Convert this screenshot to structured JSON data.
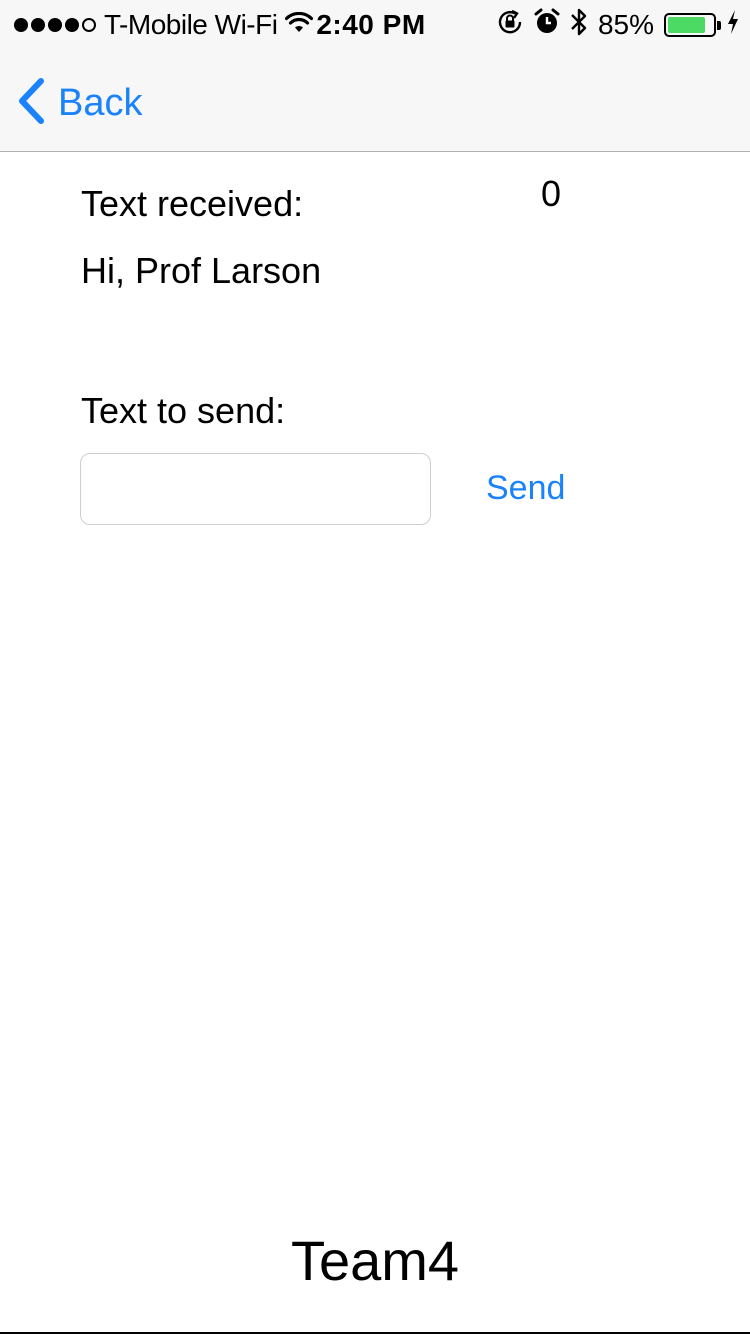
{
  "status_bar": {
    "carrier": "T-Mobile Wi-Fi",
    "time": "2:40 PM",
    "battery_percent": "85%",
    "battery_level": 0.85,
    "icons": [
      "signal-dots",
      "wifi-icon",
      "orientation-lock-icon",
      "alarm-icon",
      "bluetooth-icon",
      "battery-icon",
      "charging-bolt-icon"
    ]
  },
  "nav": {
    "back_label": "Back"
  },
  "main": {
    "received_label": "Text received:",
    "received_count": "0",
    "received_text": "Hi, Prof Larson",
    "send_label": "Text to send:",
    "send_input_value": "",
    "send_input_placeholder": "",
    "send_button_label": "Send"
  },
  "footer": {
    "title": "Team4"
  },
  "colors": {
    "accent": "#1a82fb",
    "battery": "#4cd964",
    "bar_background": "#f7f7f7"
  }
}
